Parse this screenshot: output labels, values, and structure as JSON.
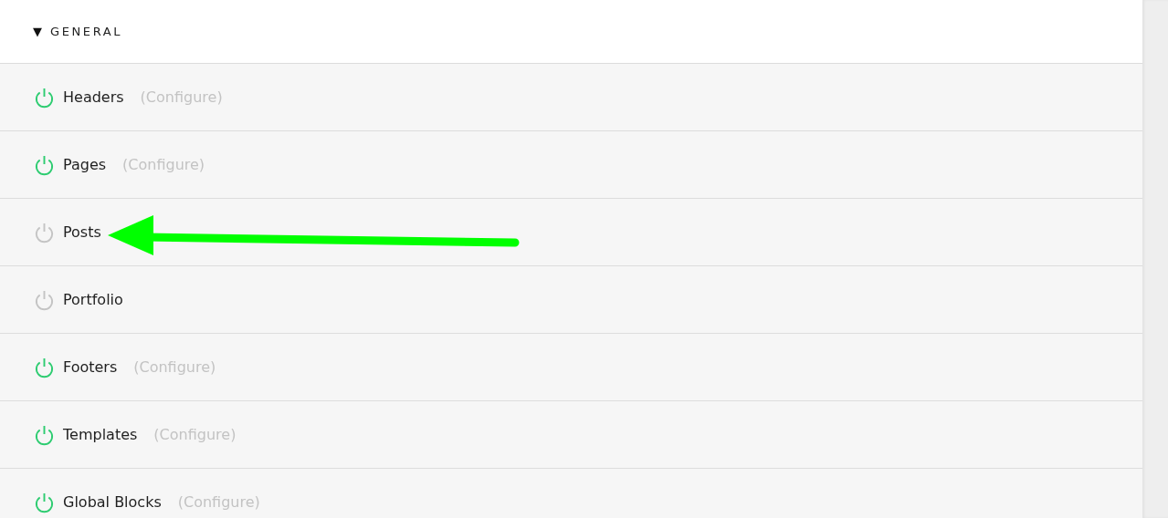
{
  "section": {
    "toggle": "▼",
    "title": "GENERAL",
    "expanded": true
  },
  "modules": [
    {
      "name": "Headers",
      "on": true,
      "configure": "(Configure)"
    },
    {
      "name": "Pages",
      "on": true,
      "configure": "(Configure)"
    },
    {
      "name": "Posts",
      "on": false
    },
    {
      "name": "Portfolio",
      "on": false
    },
    {
      "name": "Footers",
      "on": true,
      "configure": "(Configure)"
    },
    {
      "name": "Templates",
      "on": true,
      "configure": "(Configure)"
    },
    {
      "name": "Global Blocks",
      "on": true,
      "configure": "(Configure)"
    }
  ]
}
